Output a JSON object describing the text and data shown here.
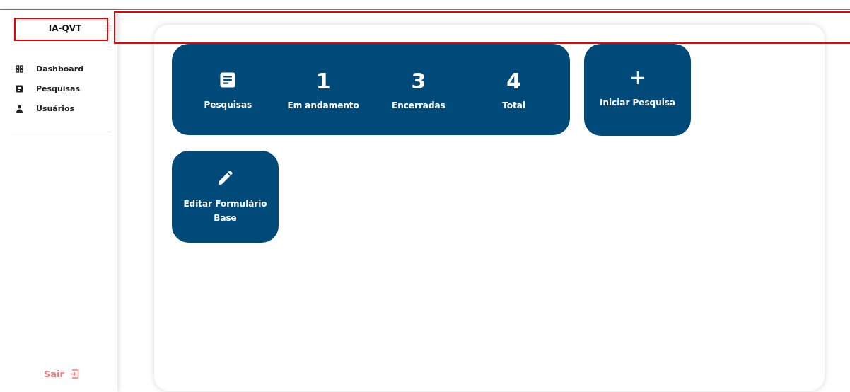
{
  "sidebar": {
    "title": "IA-QVT",
    "items": [
      {
        "label": "Dashboard",
        "kind": "grid"
      },
      {
        "label": "Pesquisas",
        "kind": "doc"
      },
      {
        "label": "Usuários",
        "kind": "user"
      }
    ],
    "logout": "Sair"
  },
  "stats": {
    "label": "Pesquisas",
    "values": [
      {
        "value": "1",
        "label": "Em andamento"
      },
      {
        "value": "3",
        "label": "Encerradas"
      },
      {
        "value": "4",
        "label": "Total"
      }
    ]
  },
  "actions": [
    {
      "label": "Iniciar Pesquisa",
      "kind": "plus"
    },
    {
      "label": "Editar Formulário Base",
      "kind": "edit"
    }
  ]
}
